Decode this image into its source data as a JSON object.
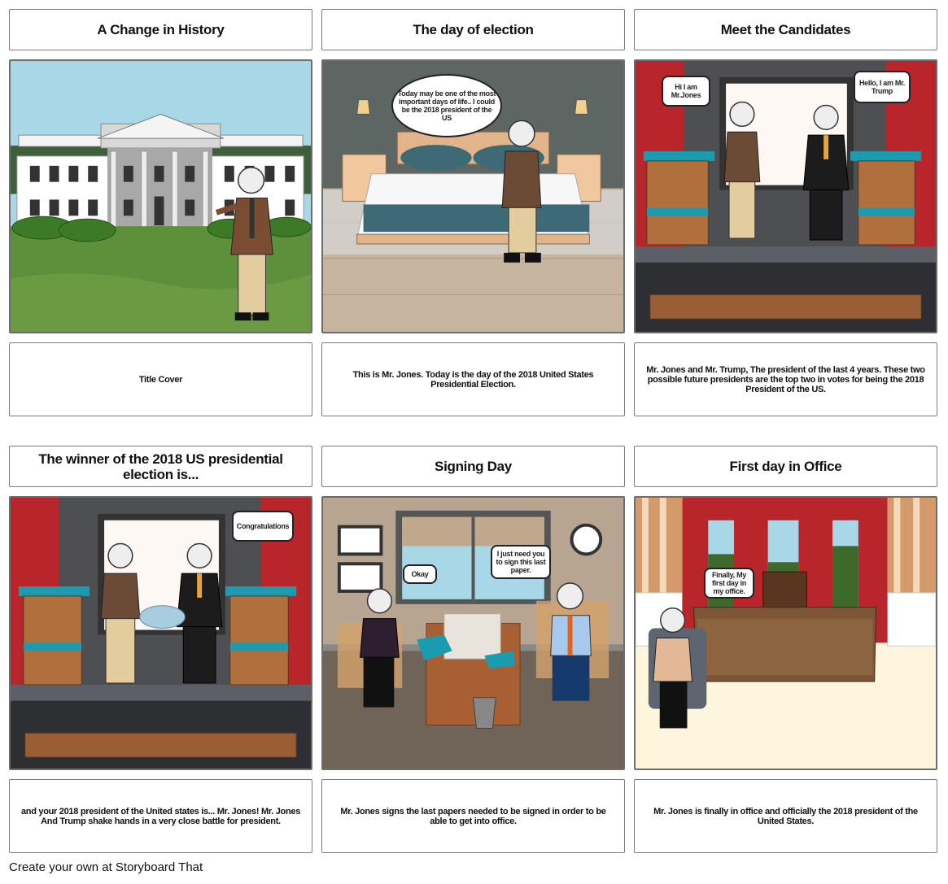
{
  "storyboard": {
    "panels": [
      {
        "title": "A Change in History",
        "caption": "Title Cover",
        "scene": "white-house-lawn",
        "bubbles": []
      },
      {
        "title": "The day of election",
        "caption": "This is Mr. Jones. Today is the day of the 2018 United States Presidential Election.",
        "scene": "bedroom",
        "bubbles": [
          "Today may be one of the most important days of life.. I could be the 2018 president of the US"
        ]
      },
      {
        "title": "Meet the Candidates",
        "caption": "Mr. Jones and Mr. Trump, The president of the last 4 years. These two possible future presidents are the top two in votes for being the 2018 President of the US.",
        "scene": "debate-stage",
        "bubbles": [
          "Hi I am Mr.Jones",
          "Hello, I am Mr. Trump"
        ]
      },
      {
        "title": "The winner of the 2018 US presidential election is...",
        "caption": "and your 2018 president of the United states is... Mr. Jones! Mr. Jones And Trump shake hands in a very close battle for president.",
        "scene": "debate-stage-handshake",
        "bubbles": [
          "Congratulations"
        ]
      },
      {
        "title": "Signing Day",
        "caption": "Mr. Jones signs the last papers needed to be signed in order to be able to get into office.",
        "scene": "office",
        "bubbles": [
          "Okay",
          "I just need you to sign this last paper."
        ]
      },
      {
        "title": "First day in Office",
        "caption": "Mr. Jones is finally in office and officially the 2018 president of the United States.",
        "scene": "oval-office",
        "bubbles": [
          "Finally, My first day in my office."
        ]
      }
    ]
  },
  "footer": {
    "text": "Create your own at Storyboard That"
  },
  "colors": {
    "sky": "#a8d8e8",
    "grass": "#5e8f3a",
    "curtain_red": "#b8262c",
    "stage_gray": "#4e4f52",
    "podium_brown": "#b06f3c",
    "podium_stripe": "#1a9bb0",
    "office_wall": "#b7a592",
    "office_floor": "#706459",
    "oval_floor": "#fdf6dc",
    "bedroom_wall": "#5d6663",
    "bedroom_floor": "#c6b49e"
  }
}
